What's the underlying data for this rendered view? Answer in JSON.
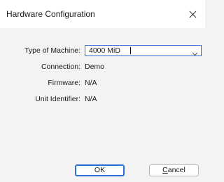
{
  "window": {
    "title": "Hardware Configuration",
    "close_icon": "close-icon"
  },
  "form": {
    "machine_label": "Type of Machine:",
    "machine_value": "4000 MiD",
    "connection_label": "Connection:",
    "connection_value": "Demo",
    "firmware_label": "Firmware:",
    "firmware_value": "N/A",
    "unit_label": "Unit Identifier:",
    "unit_value": "N/A"
  },
  "buttons": {
    "ok_label": "OK",
    "cancel_label": "Cancel"
  },
  "colors": {
    "accent": "#2b6fd6",
    "background": "#f3f3f3",
    "titlebar": "#ffffff"
  }
}
